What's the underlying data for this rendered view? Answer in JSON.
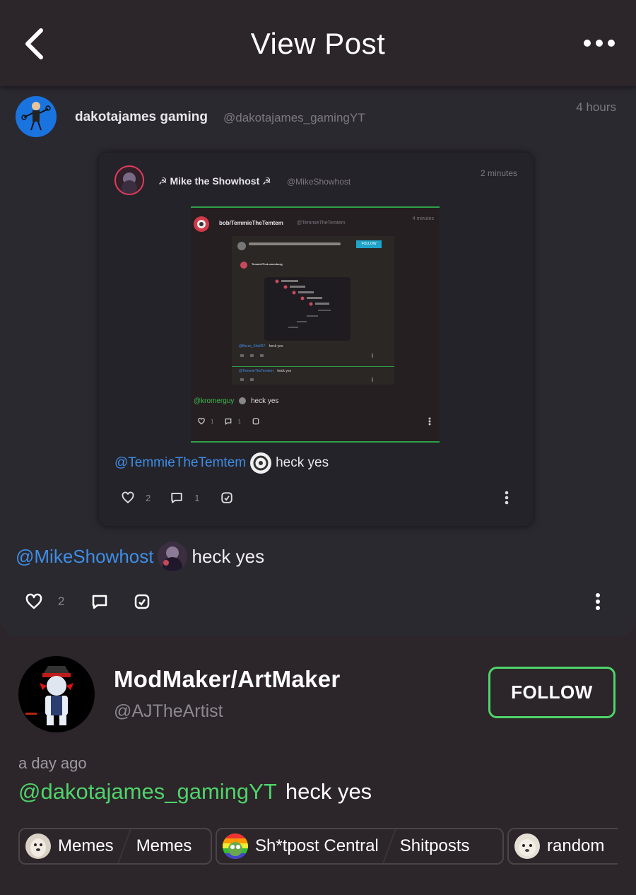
{
  "header": {
    "title": "View Post"
  },
  "post": {
    "author_name": "dakotajames gaming",
    "author_handle": "@dakotajames_gamingYT",
    "time": "4 hours",
    "reply_mention": "@MikeShowhost",
    "reply_text": "heck yes",
    "likes": "2",
    "quoted": {
      "author_name": "☭ Mike the Showhost ☭",
      "author_handle": "@MikeShowhost",
      "time": "2 minutes",
      "reply_mention": "@TemmieTheTemtem",
      "reply_text": "heck yes",
      "likes": "2",
      "comments": "1",
      "quoted": {
        "author_name": "bob/TemmieTheTemtem",
        "author_handle": "@TemmieTheTemtem",
        "time": "4 minutes",
        "reply_mention": "@kromerguy",
        "reply_text": "heck yes",
        "likes": "1",
        "comments": "1",
        "quoted": {
          "button_label": "FOLLOW",
          "author_name": "TemmieTheLuxemburg",
          "reply1_mention": "@Beuls_Shelf67",
          "reply1_text": "heck yes",
          "reply2_mention": "@TemmieTheTemtem",
          "reply2_text": "heck yes"
        }
      }
    }
  },
  "author": {
    "name": "ModMaker/ArtMaker",
    "handle": "@AJTheArtist",
    "follow_label": "FOLLOW",
    "time": "a day ago",
    "mention": "@dakotajames_gamingYT",
    "text": "heck yes"
  },
  "chips": [
    {
      "community": "Memes",
      "category": "Memes"
    },
    {
      "community": "Sh*tpost Central",
      "category": "Shitposts"
    },
    {
      "community": "random",
      "category": ""
    }
  ],
  "colors": {
    "accent_green": "#4fd36a",
    "mention_blue": "#3d8ee6",
    "bg": "#2c2529",
    "card": "#2b2930"
  }
}
